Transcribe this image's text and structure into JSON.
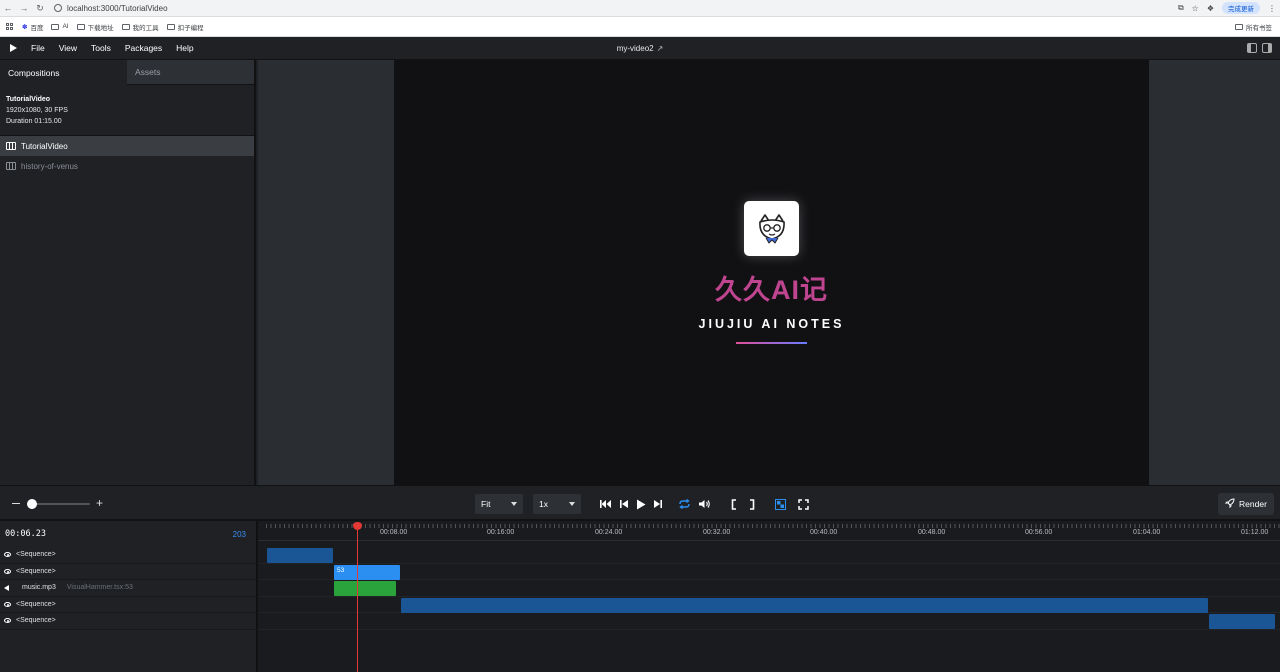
{
  "browser": {
    "url": "localhost:3000/TutorialVideo",
    "update_label": "完成更新",
    "bookmarks": [
      "百度",
      "AI",
      "下载地址",
      "我的工具",
      "扣子编程"
    ],
    "all_bookmarks": "所有书签"
  },
  "menubar": {
    "items": [
      "File",
      "View",
      "Tools",
      "Packages",
      "Help"
    ],
    "project_title": "my-video2"
  },
  "sidebar": {
    "tabs": [
      "Compositions",
      "Assets"
    ],
    "active_comp": {
      "name": "TutorialVideo",
      "resolution": "1920x1080, 30 FPS",
      "duration": "Duration 01:15.00"
    },
    "compositions": [
      "TutorialVideo",
      "history-of-venus"
    ]
  },
  "preview": {
    "headline": "久久AI记",
    "subline": "JIUJIU AI NOTES"
  },
  "controls": {
    "size_select": "Fit",
    "speed_select": "1x",
    "render_label": "Render"
  },
  "timeline": {
    "current_time": "00:06.23",
    "current_frame": "203",
    "ruler_labels": [
      "00:08.00",
      "00:16:00",
      "00:24.00",
      "00:32.00",
      "00:40.00",
      "00:48.00",
      "00:56.00",
      "01:04.00",
      "01:12.00"
    ],
    "tracks": [
      {
        "label": "<Sequence>",
        "sub": ""
      },
      {
        "label": "<Sequence>",
        "sub": ""
      },
      {
        "label": "music.mp3",
        "sub": "VisualHammer.tsx:53"
      },
      {
        "label": "<Sequence>",
        "sub": ""
      },
      {
        "label": "<Sequence>",
        "sub": ""
      }
    ],
    "clip_label": "53"
  },
  "colors": {
    "accent": "#2a8ff0",
    "playhead": "#e53935",
    "headline": "#c04590",
    "clip_blue": "#1a5596",
    "clip_green": "#2aa33c"
  }
}
